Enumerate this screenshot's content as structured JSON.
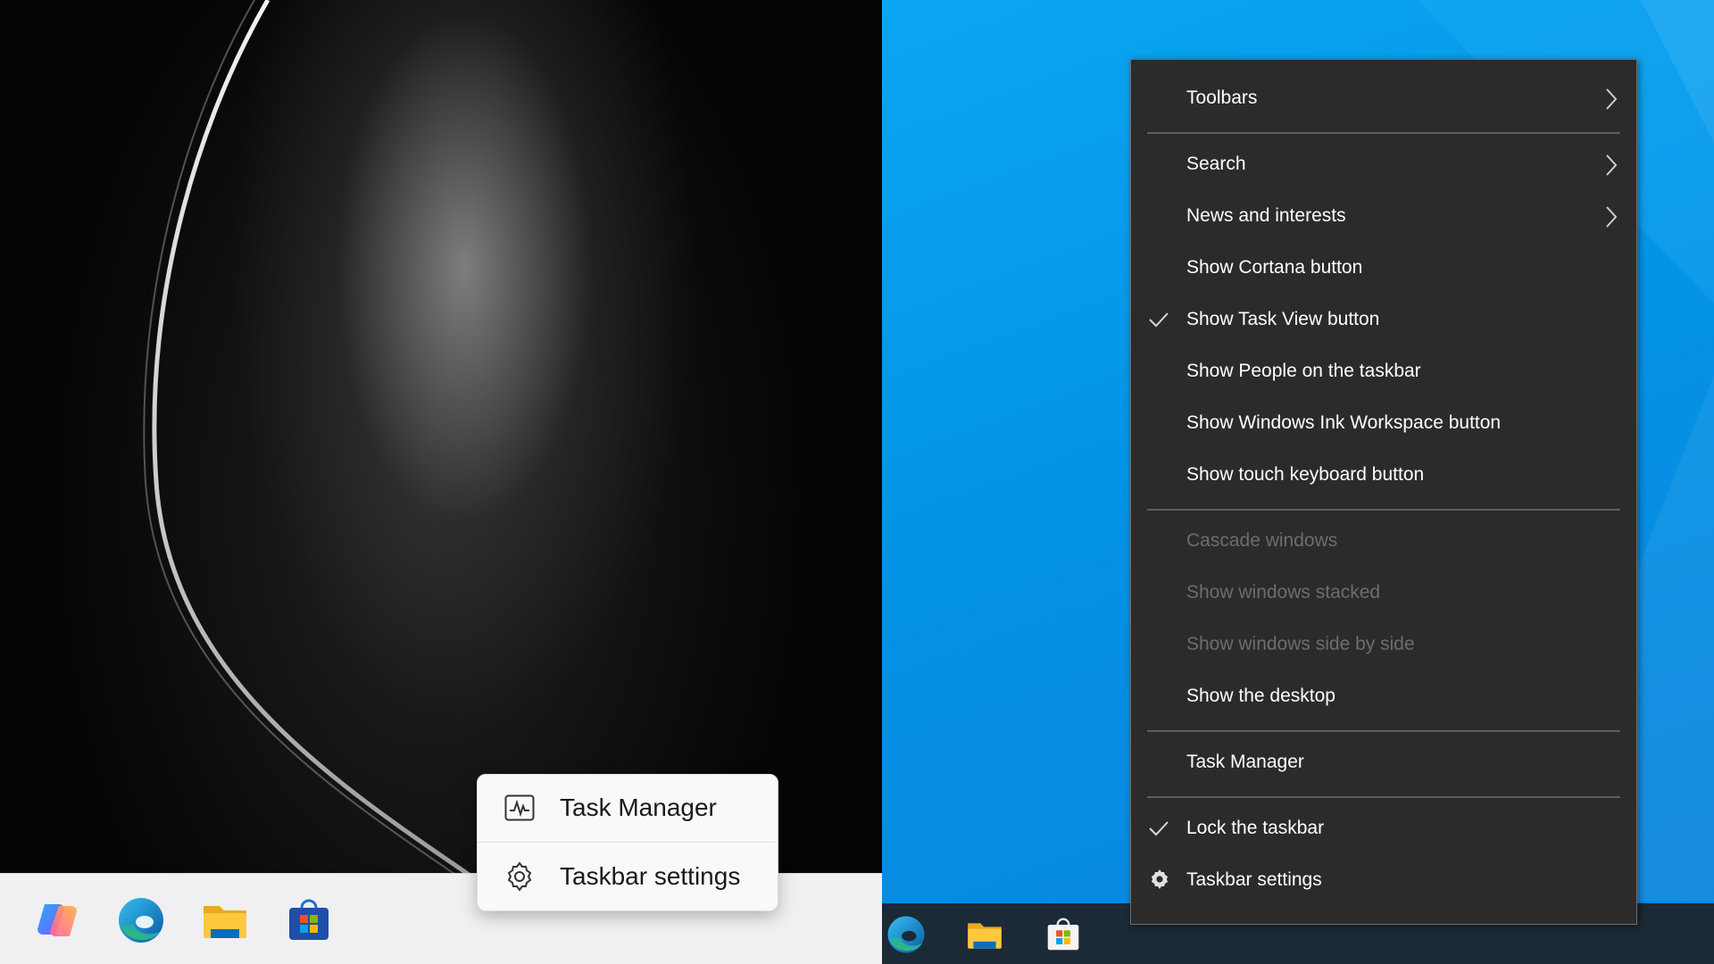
{
  "win11": {
    "taskbar": {
      "icons": [
        "copilot-icon",
        "edge-icon",
        "file-explorer-icon",
        "microsoft-store-icon"
      ]
    },
    "context_menu": {
      "task_manager": "Task Manager",
      "taskbar_settings": "Taskbar settings"
    }
  },
  "win10": {
    "taskbar": {
      "icons": [
        "edge-icon",
        "file-explorer-icon",
        "microsoft-store-icon"
      ]
    },
    "context_menu": {
      "toolbars": "Toolbars",
      "search": "Search",
      "news_and_interests": "News and interests",
      "show_cortana_button": "Show Cortana button",
      "show_task_view_button": "Show Task View button",
      "show_people": "Show People on the taskbar",
      "show_ink_workspace": "Show Windows Ink Workspace button",
      "show_touch_keyboard": "Show touch keyboard button",
      "cascade_windows": "Cascade windows",
      "show_windows_stacked": "Show windows stacked",
      "show_windows_side_by_side": "Show windows side by side",
      "show_the_desktop": "Show the desktop",
      "task_manager": "Task Manager",
      "lock_the_taskbar": "Lock the taskbar",
      "taskbar_settings": "Taskbar settings"
    },
    "checked_items": [
      "show_task_view_button",
      "lock_the_taskbar"
    ],
    "disabled_items": [
      "cascade_windows",
      "show_windows_stacked",
      "show_windows_side_by_side"
    ]
  },
  "colors": {
    "w10_menu_bg": "#2b2b2b",
    "w10_desktop_blue": "#0493e6",
    "w11_menu_bg": "#f9f9fb"
  }
}
